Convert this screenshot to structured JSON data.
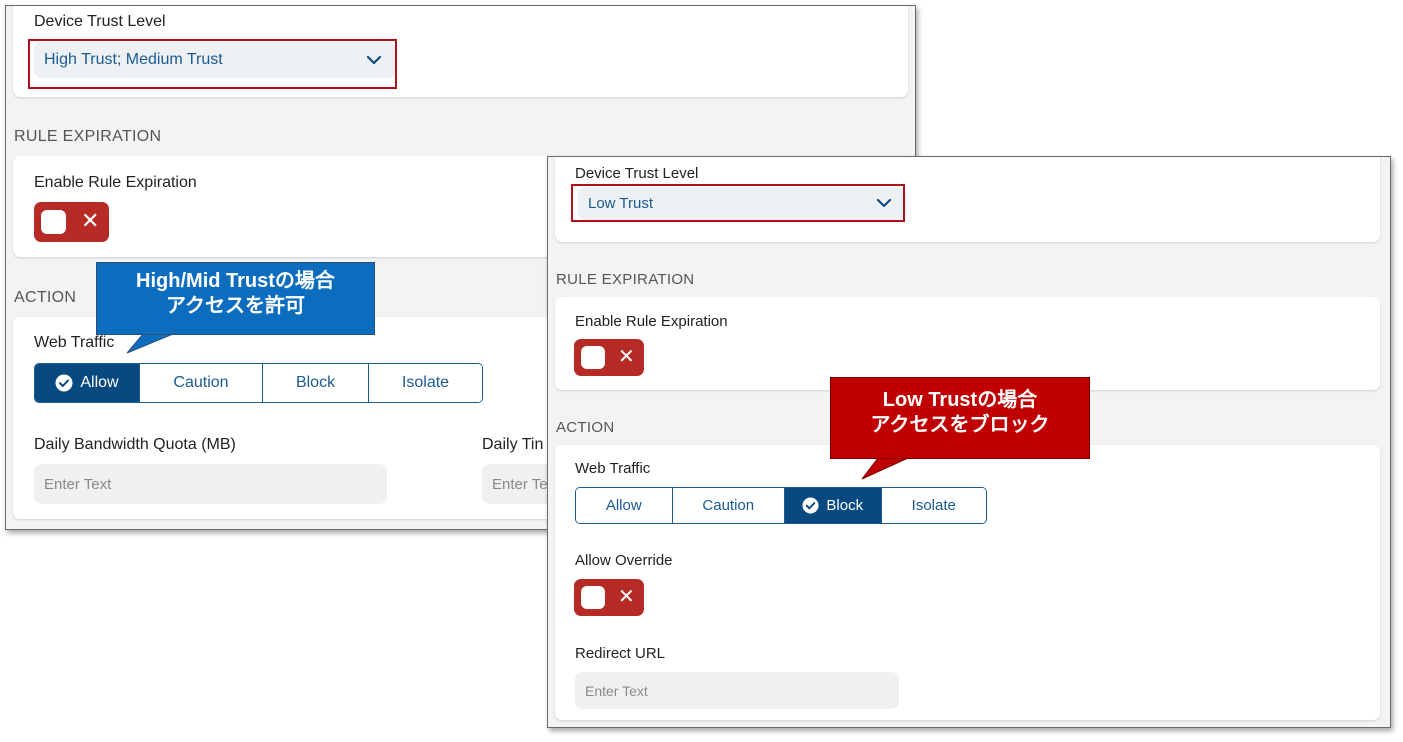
{
  "colors": {
    "accent": "#08497f",
    "link_text": "#1b5a93",
    "toggle_off": "#b62b26",
    "highlight_box": "#b0101a",
    "callout_blue": "#0c6dbf",
    "callout_red": "#c00000"
  },
  "panel1": {
    "device_trust_label": "Device Trust Level",
    "device_trust_value": "High Trust; Medium Trust",
    "rule_expiration_section": "RULE EXPIRATION",
    "enable_rule_expiration_label": "Enable Rule Expiration",
    "action_section": "ACTION",
    "web_traffic_label": "Web Traffic",
    "web_traffic_options": [
      "Allow",
      "Caution",
      "Block",
      "Isolate"
    ],
    "web_traffic_selected": "Allow",
    "daily_bandwidth_label": "Daily Bandwidth Quota (MB)",
    "daily_bandwidth_placeholder": "Enter Text",
    "daily_time_label": "Daily Tin",
    "daily_time_placeholder": "Enter Te",
    "icons": {
      "dropdown": "chevron-down-icon",
      "toggle_state": "close-icon",
      "selected": "check-circle-icon"
    }
  },
  "panel2": {
    "device_trust_label": "Device Trust Level",
    "device_trust_value": "Low Trust",
    "rule_expiration_section": "RULE EXPIRATION",
    "enable_rule_expiration_label": "Enable Rule Expiration",
    "action_section": "ACTION",
    "web_traffic_label": "Web Traffic",
    "web_traffic_options": [
      "Allow",
      "Caution",
      "Block",
      "Isolate"
    ],
    "web_traffic_selected": "Block",
    "allow_override_label": "Allow Override",
    "redirect_url_label": "Redirect URL",
    "redirect_url_placeholder": "Enter Text",
    "icons": {
      "dropdown": "chevron-down-icon",
      "toggle_state": "close-icon",
      "selected": "check-circle-icon"
    }
  },
  "callouts": {
    "high_mid": {
      "line1": "High/Mid Trustの場合",
      "line2": "アクセスを許可"
    },
    "low": {
      "line1": "Low Trustの場合",
      "line2": "アクセスをブロック"
    }
  }
}
